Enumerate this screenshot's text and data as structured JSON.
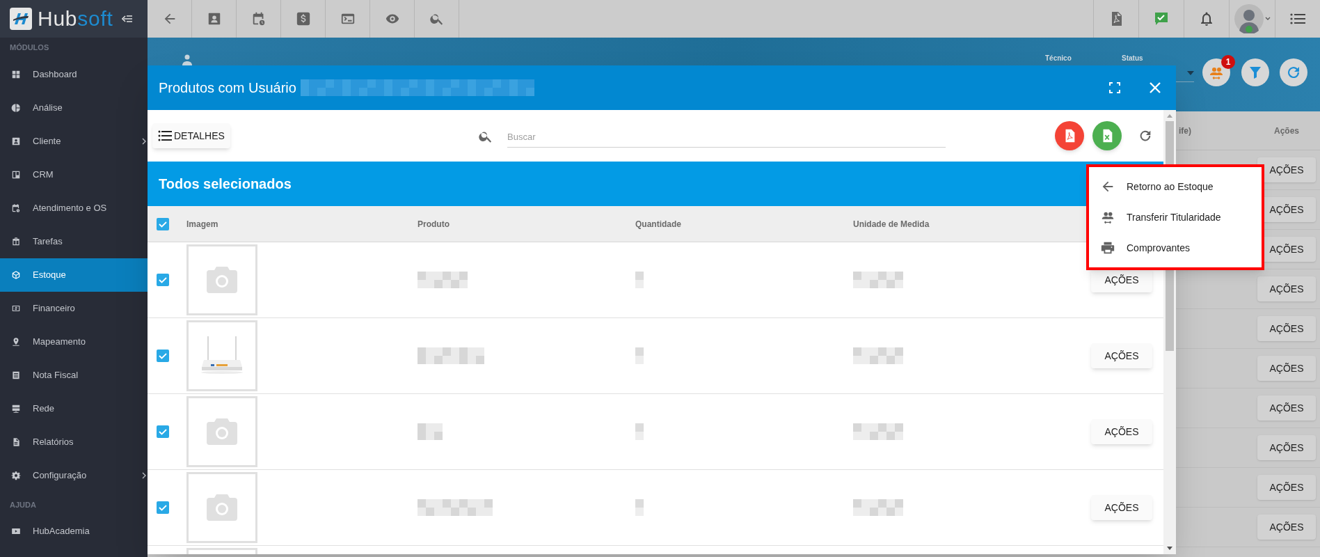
{
  "logo": {
    "parts": [
      "Hub",
      "soft"
    ]
  },
  "sidebar": {
    "sections": [
      {
        "title": "MÓDULOS",
        "items": [
          {
            "label": "Dashboard",
            "selected": false,
            "submenu": false
          },
          {
            "label": "Análise",
            "selected": false,
            "submenu": false
          },
          {
            "label": "Cliente",
            "selected": false,
            "submenu": true
          },
          {
            "label": "CRM",
            "selected": false,
            "submenu": false
          },
          {
            "label": "Atendimento e OS",
            "selected": false,
            "submenu": false
          },
          {
            "label": "Tarefas",
            "selected": false,
            "submenu": false
          },
          {
            "label": "Estoque",
            "selected": true,
            "submenu": false
          },
          {
            "label": "Financeiro",
            "selected": false,
            "submenu": false
          },
          {
            "label": "Mapeamento",
            "selected": false,
            "submenu": false
          },
          {
            "label": "Nota Fiscal",
            "selected": false,
            "submenu": false
          },
          {
            "label": "Rede",
            "selected": false,
            "submenu": false
          },
          {
            "label": "Relatórios",
            "selected": false,
            "submenu": false
          },
          {
            "label": "Configuração",
            "selected": false,
            "submenu": true
          }
        ]
      },
      {
        "title": "AJUDA",
        "items": [
          {
            "label": "HubAcademia",
            "selected": false,
            "submenu": false
          }
        ]
      }
    ]
  },
  "page": {
    "filters": [
      "Técnico",
      "Status"
    ],
    "badge": "1",
    "table": {
      "columns": [
        "ife)",
        "Ações"
      ],
      "rows": [
        "AÇÕES",
        "AÇÕES",
        "AÇÕES",
        "AÇÕES",
        "AÇÕES",
        "AÇÕES",
        "AÇÕES",
        "AÇÕES",
        "AÇÕES",
        "AÇÕES"
      ]
    }
  },
  "modal": {
    "title": "Produtos com Usuário",
    "details_button": "DETALHES",
    "search": {
      "placeholder": "Buscar"
    },
    "banner": "Todos selecionados",
    "select_all": {
      "checked": true
    },
    "columns": [
      "Imagem",
      "Produto",
      "Quantidade",
      "Unidade de Medida"
    ],
    "rows": [
      {
        "checked": true,
        "kind": "placeholder",
        "action": "AÇÕES"
      },
      {
        "checked": true,
        "kind": "picture",
        "action": "AÇÕES"
      },
      {
        "checked": true,
        "kind": "placeholder",
        "action": "AÇÕES"
      },
      {
        "checked": true,
        "kind": "placeholder",
        "action": "AÇÕES"
      }
    ],
    "menu": [
      {
        "kind": "back",
        "label": "Retorno ao Estoque"
      },
      {
        "kind": "transfer",
        "label": "Transferir Titularidade"
      },
      {
        "kind": "print",
        "label": "Comprovantes"
      }
    ]
  }
}
